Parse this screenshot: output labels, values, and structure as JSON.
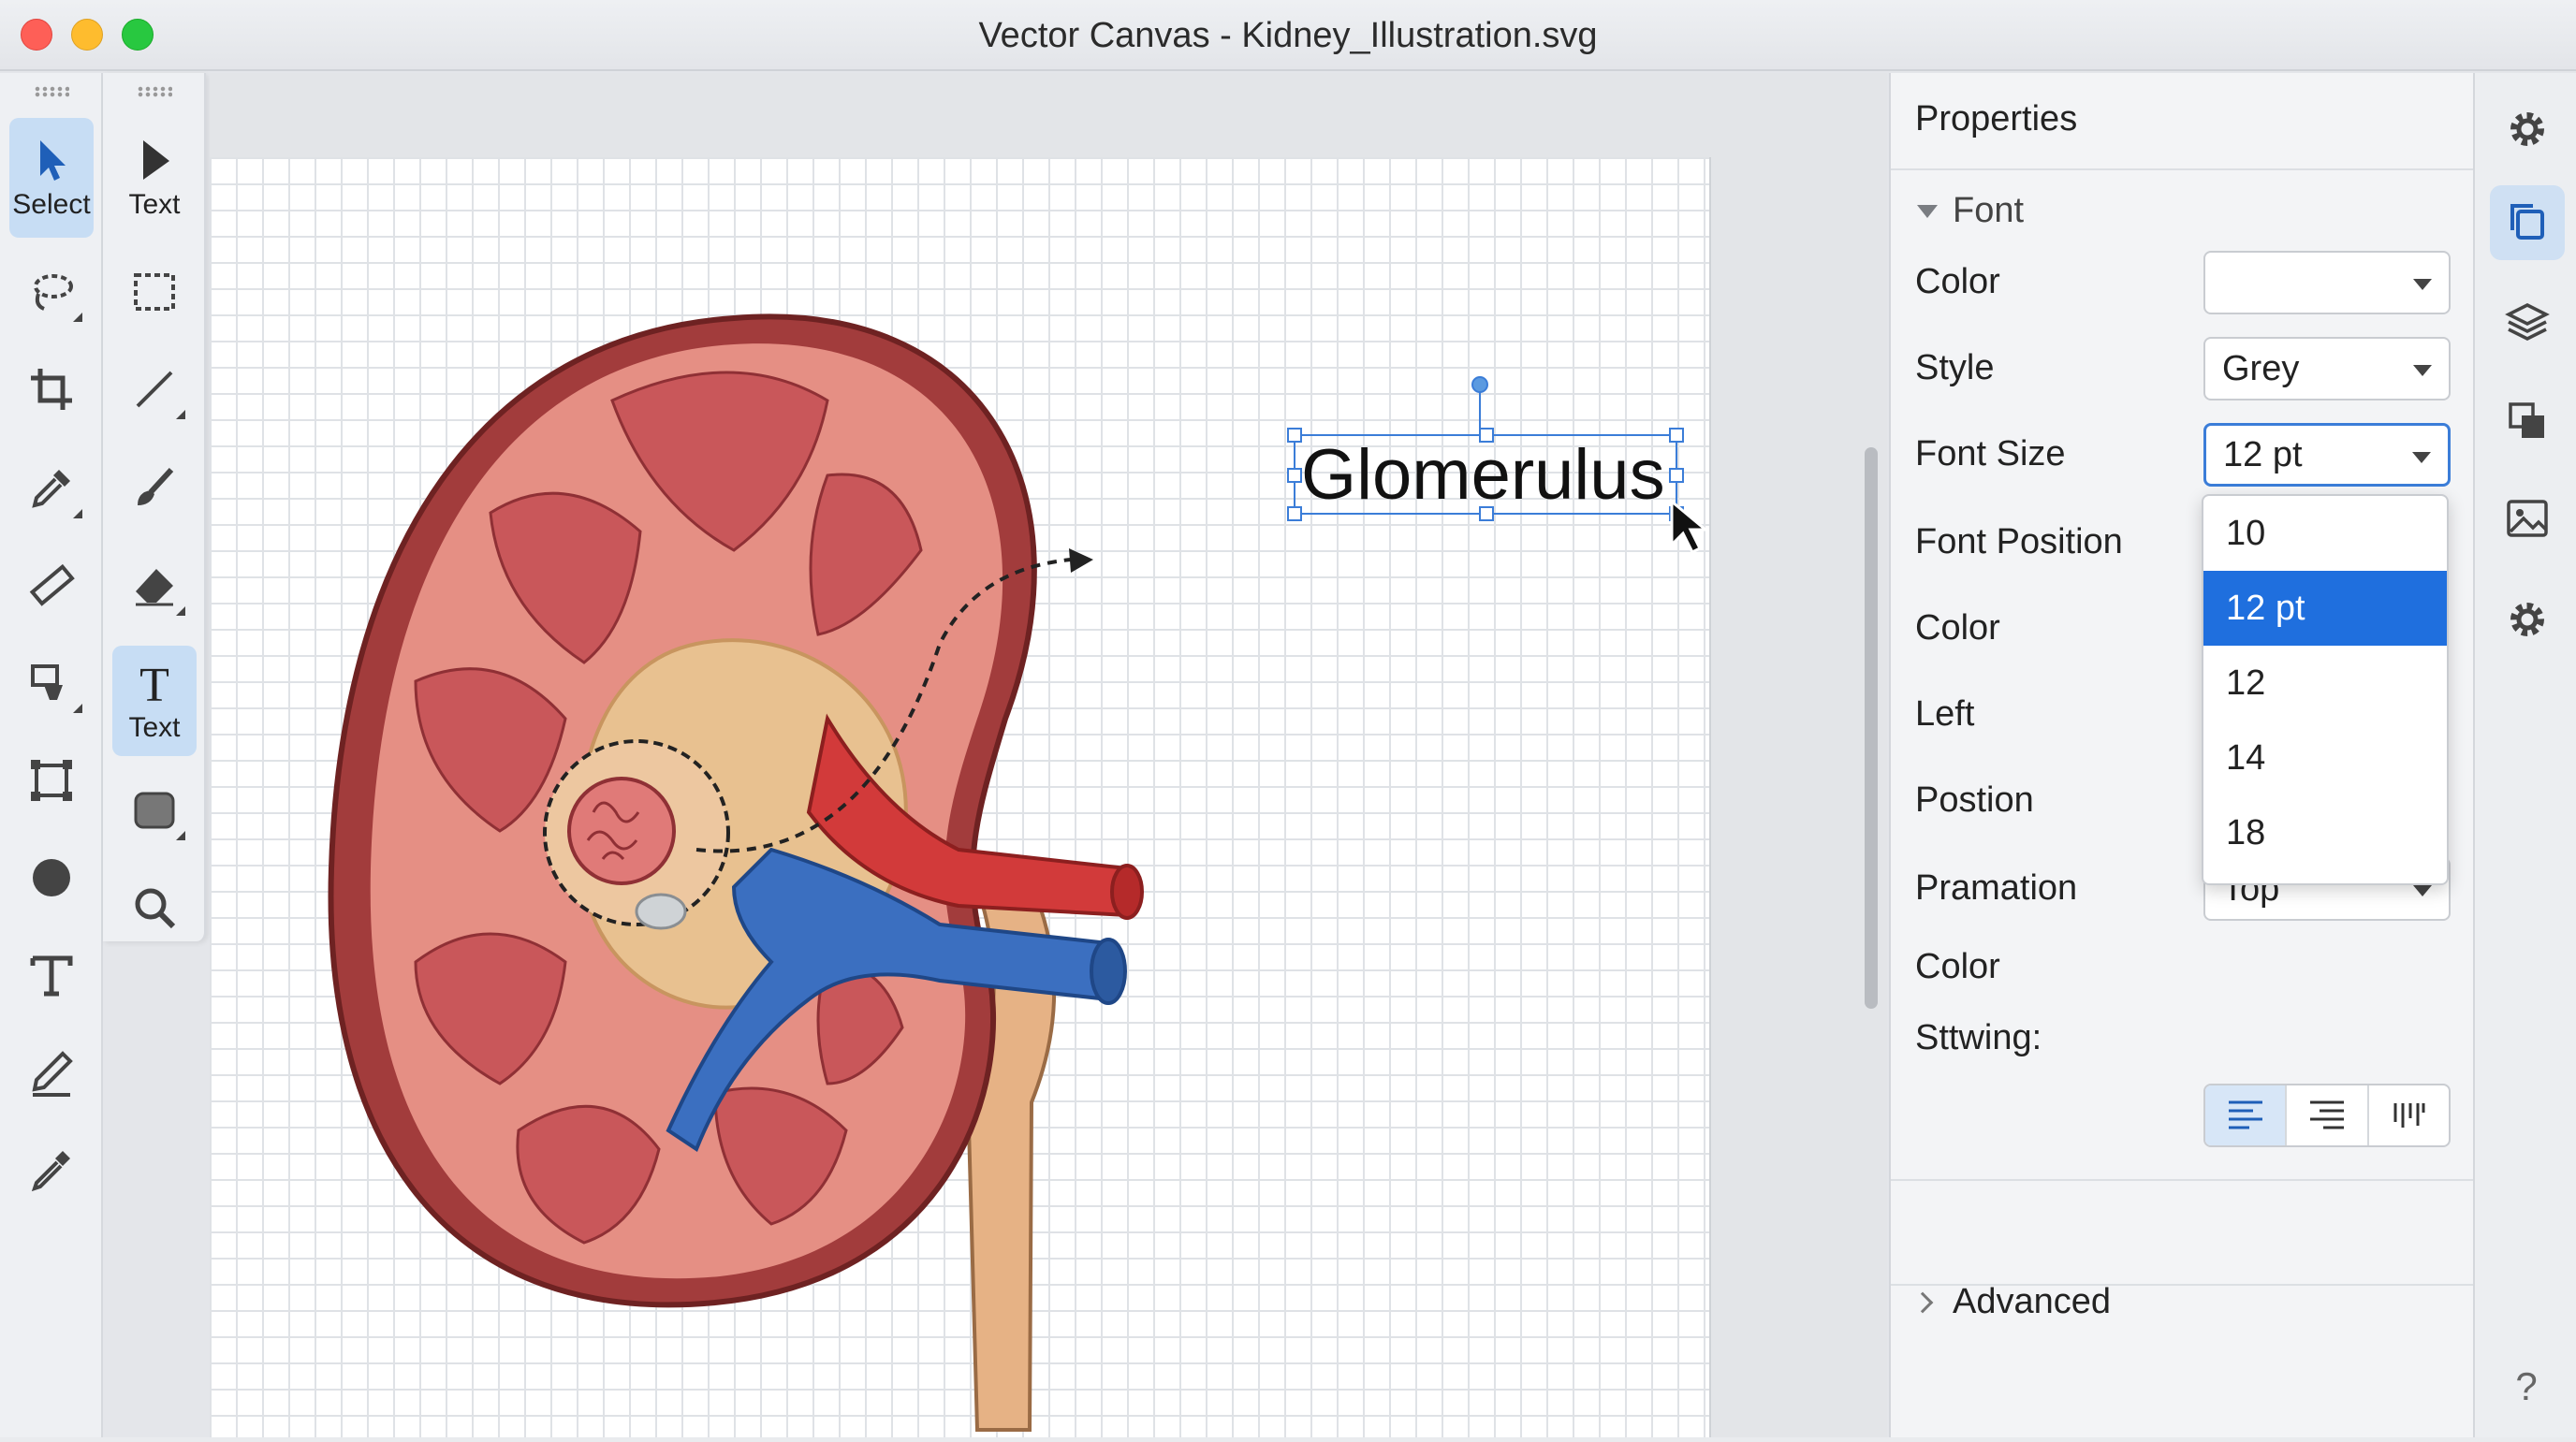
{
  "window": {
    "title": "Vector Canvas - Kidney_Illustration.svg"
  },
  "toolbar_left": {
    "select_label": "Select",
    "text_label": "Text"
  },
  "toolbar_secondary": {
    "select_label": "Text",
    "text_label": "Text"
  },
  "canvas": {
    "text_object": "Glomerulus"
  },
  "properties": {
    "title": "Properties",
    "font_section": "Font",
    "rows": {
      "color_1": "Color",
      "style": "Style",
      "font_size": "Font Size",
      "font_position": "Font Position",
      "color_2": "Color",
      "left": "Left",
      "position": "Postion",
      "pramation": "Pramation",
      "color_3": "Color",
      "sttwing": "Sttwing:"
    },
    "style_value": "Grey",
    "font_size_value": "12 pt",
    "pramation_value": "Top",
    "font_size_options": [
      "10",
      "12 pt",
      "12",
      "14",
      "18"
    ],
    "font_size_selected_index": 1,
    "advanced": "Advanced"
  },
  "help": "?",
  "colors": {
    "accent": "#1f6fde",
    "artery": "#d23a3a",
    "vein": "#3b6fc0",
    "kidney_outer": "#a8403f"
  }
}
